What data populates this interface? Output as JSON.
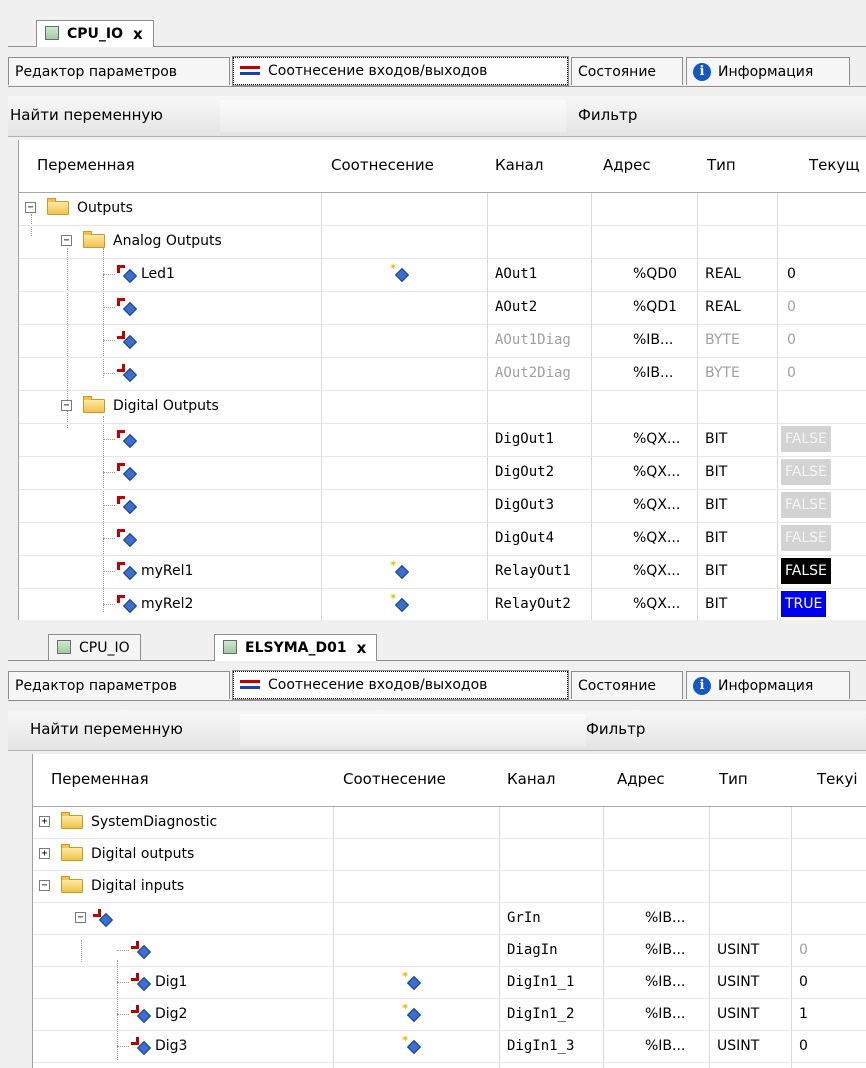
{
  "top": {
    "doc_tab": {
      "label": "CPU_IO",
      "close": "x"
    },
    "subtabs": [
      "Редактор параметров",
      "Соотнесение входов/выходов",
      "Состояние",
      "Информация"
    ],
    "search": {
      "find_label": "Найти переменную",
      "filter_label": "Фильтр"
    },
    "columns": [
      "Переменная",
      "Соотнесение",
      "Канал",
      "Адрес",
      "Тип",
      "Текущ"
    ],
    "rows": [
      {
        "name": "Outputs",
        "channel": "",
        "address": "",
        "type": "",
        "value": ""
      },
      {
        "name": "Analog Outputs",
        "channel": "",
        "address": "",
        "type": "",
        "value": ""
      },
      {
        "name": "Led1",
        "channel": "AOut1",
        "address": "%QD0",
        "type": "REAL",
        "value": "0"
      },
      {
        "name": "",
        "channel": "AOut2",
        "address": "%QD1",
        "type": "REAL",
        "value": "0"
      },
      {
        "name": "",
        "channel": "AOut1Diag",
        "address": "%IB...",
        "type": "BYTE",
        "value": "0"
      },
      {
        "name": "",
        "channel": "AOut2Diag",
        "address": "%IB...",
        "type": "BYTE",
        "value": "0"
      },
      {
        "name": "Digital Outputs",
        "channel": "",
        "address": "",
        "type": "",
        "value": ""
      },
      {
        "name": "",
        "channel": "DigOut1",
        "address": "%QX...",
        "type": "BIT",
        "value": "FALSE"
      },
      {
        "name": "",
        "channel": "DigOut2",
        "address": "%QX...",
        "type": "BIT",
        "value": "FALSE"
      },
      {
        "name": "",
        "channel": "DigOut3",
        "address": "%QX...",
        "type": "BIT",
        "value": "FALSE"
      },
      {
        "name": "",
        "channel": "DigOut4",
        "address": "%QX...",
        "type": "BIT",
        "value": "FALSE"
      },
      {
        "name": "myRel1",
        "channel": "RelayOut1",
        "address": "%QX...",
        "type": "BIT",
        "value": "FALSE"
      },
      {
        "name": "myRel2",
        "channel": "RelayOut2",
        "address": "%QX...",
        "type": "BIT",
        "value": "TRUE"
      }
    ]
  },
  "bottom": {
    "doc_tabs": [
      {
        "label": "CPU_IO"
      },
      {
        "label": "ELSYMA_D01",
        "close": "x"
      }
    ],
    "subtabs": [
      "Редактор параметров",
      "Соотнесение входов/выходов",
      "Состояние",
      "Информация"
    ],
    "search": {
      "find_label": "Найти переменную",
      "filter_label": "Фильтр"
    },
    "columns": [
      "Переменная",
      "Соотнесение",
      "Канал",
      "Адрес",
      "Тип",
      "Текуі"
    ],
    "rows": [
      {
        "name": "SystemDiagnostic",
        "channel": "",
        "address": "",
        "type": "",
        "value": ""
      },
      {
        "name": "Digital outputs",
        "channel": "",
        "address": "",
        "type": "",
        "value": ""
      },
      {
        "name": "Digital inputs",
        "channel": "",
        "address": "",
        "type": "",
        "value": ""
      },
      {
        "name": "",
        "channel": "GrIn",
        "address": "%IB...",
        "type": "",
        "value": ""
      },
      {
        "name": "",
        "channel": "DiagIn",
        "address": "%IB...",
        "type": "USINT",
        "value": "0"
      },
      {
        "name": "Dig1",
        "channel": "DigIn1_1",
        "address": "%IB...",
        "type": "USINT",
        "value": "0"
      },
      {
        "name": "Dig2",
        "channel": "DigIn1_2",
        "address": "%IB...",
        "type": "USINT",
        "value": "1"
      },
      {
        "name": "Dig3",
        "channel": "DigIn1_3",
        "address": "%IB...",
        "type": "USINT",
        "value": "0"
      }
    ]
  }
}
